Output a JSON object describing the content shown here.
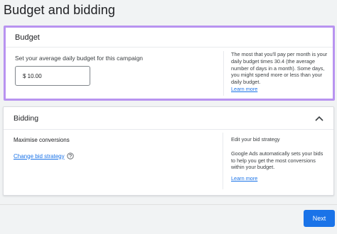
{
  "page": {
    "title": "Budget and bidding"
  },
  "budget": {
    "heading": "Budget",
    "prompt": "Set your average daily budget for this campaign",
    "input_value": "$ 10.00",
    "help_text": "The most that you'll pay per month is your daily budget times 30.4 (the average number of days in a month). Some days, you might spend more or less than your daily budget.",
    "learn_more": "Learn more",
    "highlight_color": "#b893f0"
  },
  "bidding": {
    "heading": "Bidding",
    "strategy": "Maximise conversions",
    "change_link": "Change bid strategy",
    "help_title": "Edit your bid strategy",
    "help_text": "Google Ads automatically sets your bids to help you get the most conversions within your budget.",
    "learn_more": "Learn more",
    "collapse_icon": "chevron-up-icon",
    "help_icon": "question-circle-icon"
  },
  "footer": {
    "next_label": "Next",
    "accent": "#1a73e8"
  }
}
